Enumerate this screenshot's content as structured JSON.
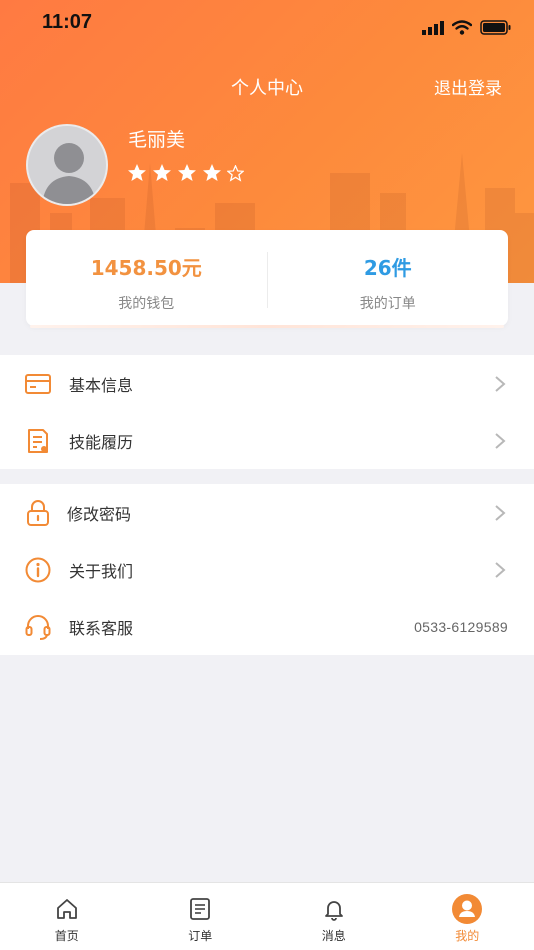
{
  "status_bar": {
    "time": "11:07"
  },
  "header": {
    "title": "个人中心",
    "logout_label": "退出登录"
  },
  "profile": {
    "name": "毛丽美",
    "rating": 4,
    "rating_max": 5
  },
  "stats": {
    "wallet": {
      "value": "1458.50元",
      "label": "我的钱包",
      "color": "#f29240"
    },
    "orders": {
      "value": "26件",
      "label": "我的订单",
      "color": "#2f9be3"
    }
  },
  "menu_group_1": [
    {
      "label": "基本信息",
      "icon": "id-card-icon"
    },
    {
      "label": "技能履历",
      "icon": "resume-icon"
    }
  ],
  "menu_group_2": [
    {
      "label": "修改密码",
      "icon": "lock-icon"
    },
    {
      "label": "关于我们",
      "icon": "info-icon"
    },
    {
      "label": "联系客服",
      "icon": "headset-icon",
      "value": "0533-6129589"
    }
  ],
  "tabbar": [
    {
      "label": "首页",
      "icon": "home-icon"
    },
    {
      "label": "订单",
      "icon": "order-icon"
    },
    {
      "label": "消息",
      "icon": "bell-icon"
    },
    {
      "label": "我的",
      "icon": "user-icon",
      "active": true
    }
  ],
  "colors": {
    "accent": "#f28a35",
    "header_start": "#ff7a42",
    "header_end": "#fe9740"
  }
}
